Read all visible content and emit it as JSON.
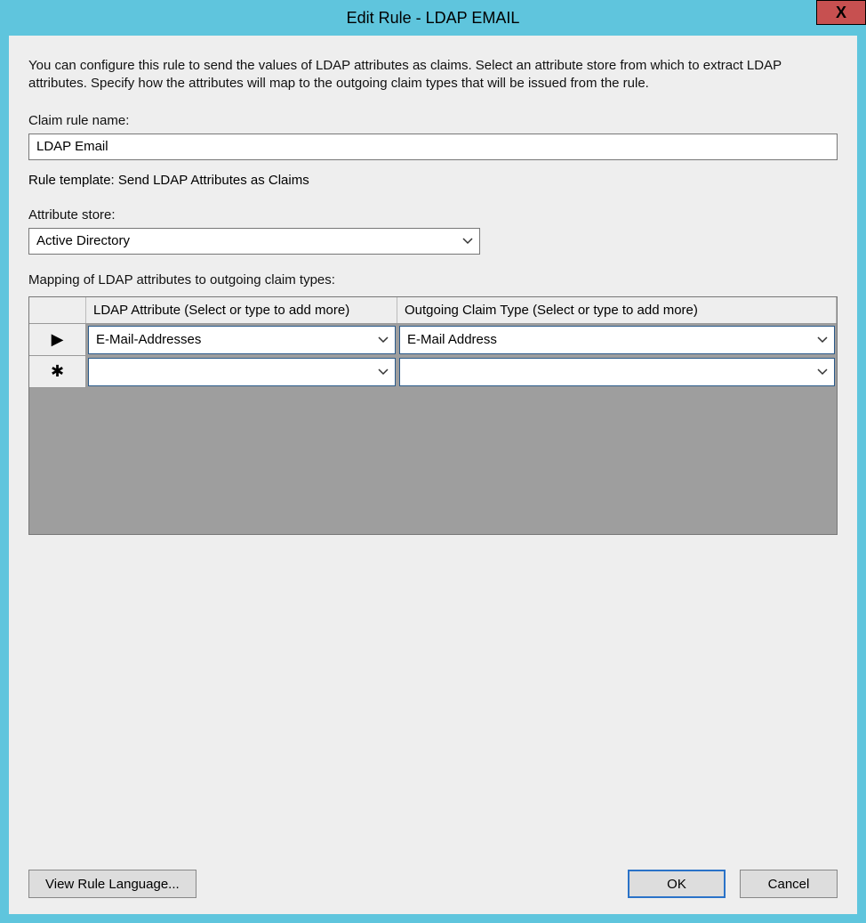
{
  "window": {
    "title": "Edit Rule - LDAP EMAIL",
    "close_label": "X"
  },
  "description": "You can configure this rule to send the values of LDAP attributes as claims. Select an attribute store from which to extract LDAP attributes. Specify how the attributes will map to the outgoing claim types that will be issued from the rule.",
  "labels": {
    "claim_rule_name": "Claim rule name:",
    "rule_template_prefix": "Rule template: ",
    "rule_template_value": "Send LDAP Attributes as Claims",
    "attribute_store": "Attribute store:",
    "mapping": "Mapping of LDAP attributes to outgoing claim types:"
  },
  "fields": {
    "claim_rule_name_value": "LDAP Email",
    "attribute_store_value": "Active Directory"
  },
  "grid": {
    "headers": {
      "ldap_attr": "LDAP Attribute (Select or type to add more)",
      "claim_type": "Outgoing Claim Type (Select or type to add more)"
    },
    "rows": [
      {
        "marker": "▶",
        "ldap_attr": "E-Mail-Addresses",
        "claim_type": "E-Mail Address"
      },
      {
        "marker": "✱",
        "ldap_attr": "",
        "claim_type": ""
      }
    ]
  },
  "buttons": {
    "view_rule_language": "View Rule Language...",
    "ok": "OK",
    "cancel": "Cancel"
  }
}
